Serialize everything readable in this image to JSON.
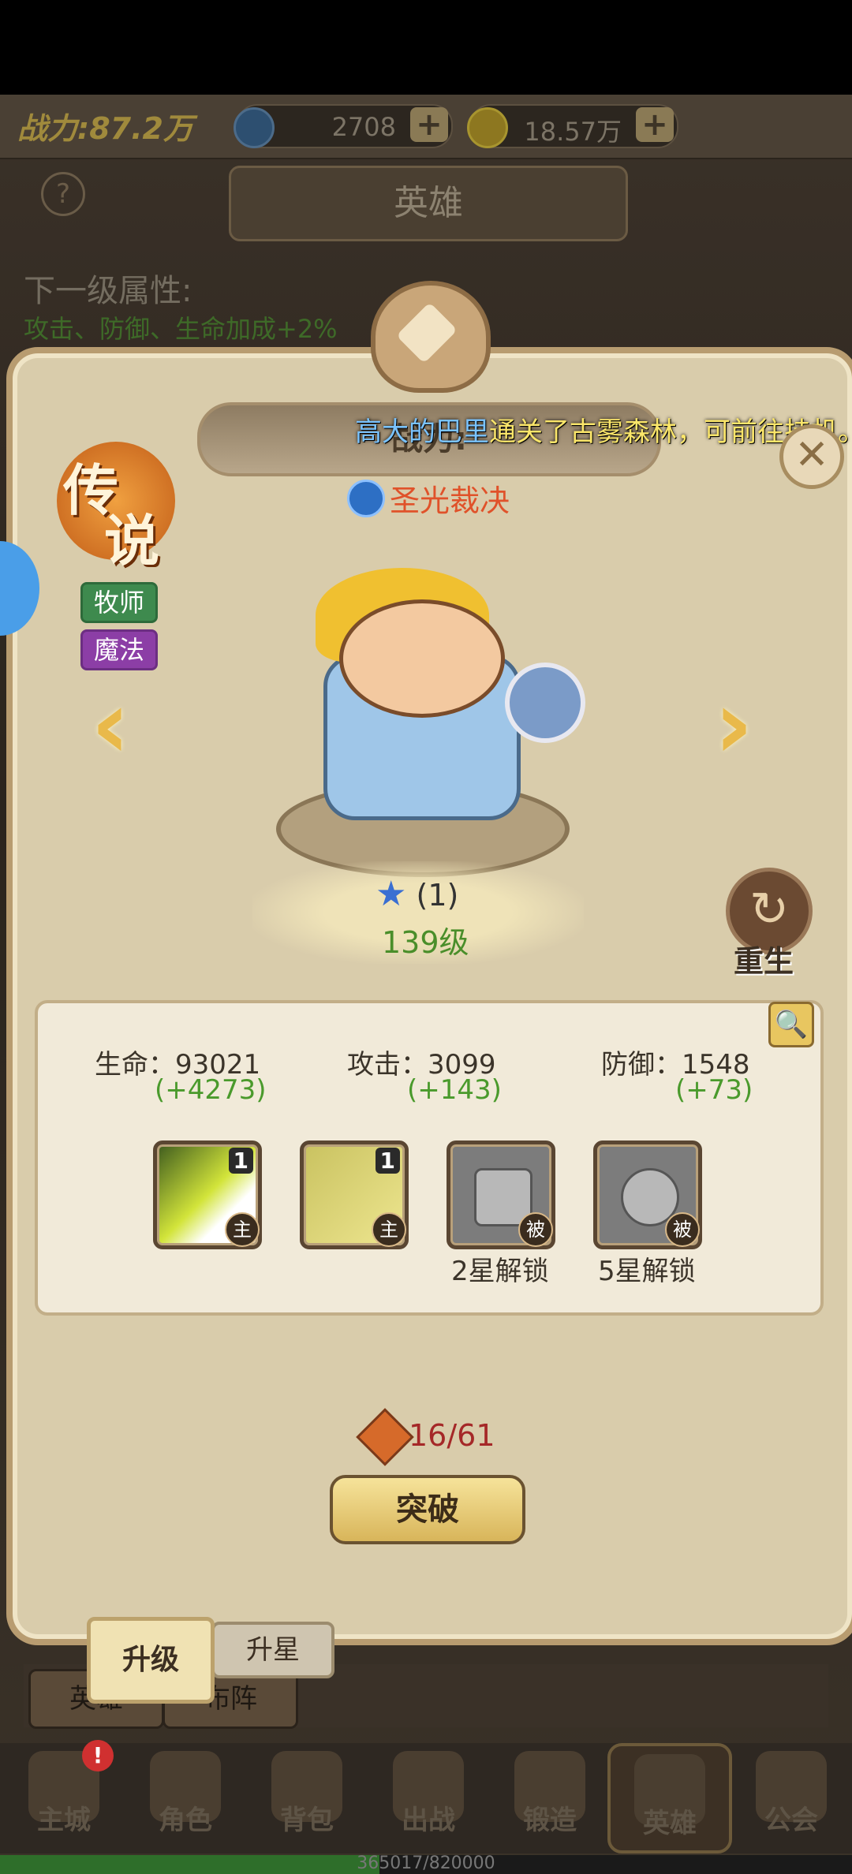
{
  "topbar": {
    "power": "战力:87.2万",
    "gems": "2708",
    "gold": "18.57万"
  },
  "page_title": "英雄",
  "help": "?",
  "next_level": {
    "title": "下一级属性:",
    "desc": "攻击、防御、生命加成+2%"
  },
  "marquee": {
    "prefix": "高大的巴里",
    "text": "通关了古雾森林，可前往挂机。"
  },
  "hero_power": "战力:",
  "close": "✕",
  "rarity": {
    "line1": "传",
    "line2": "说"
  },
  "tags": [
    "牧师",
    "魔法"
  ],
  "skill_name": "圣光裁决",
  "arrows": {
    "left": "‹",
    "right": "›"
  },
  "hero": {
    "stars": "(1)",
    "level": "139级"
  },
  "rebirth": {
    "label": "重生",
    "icon": "↻"
  },
  "stats": [
    {
      "label": "生命：93021",
      "bonus": "(+4273)"
    },
    {
      "label": "攻击：3099",
      "bonus": "(+143)"
    },
    {
      "label": "防御：1548",
      "bonus": "(+73)"
    }
  ],
  "skills": [
    {
      "count": "1",
      "mark": "主"
    },
    {
      "count": "1",
      "mark": "主"
    },
    {
      "mark": "被",
      "unlock": "2星解锁"
    },
    {
      "mark": "被",
      "unlock": "5星解锁"
    }
  ],
  "fragments": "16/61",
  "break_button": "突破",
  "tabs": {
    "upgrade": "升级",
    "star": "升星"
  },
  "subtabs": [
    "英雄",
    "布阵"
  ],
  "nav": [
    {
      "label": "主城",
      "icon": "castle-icon"
    },
    {
      "label": "角色",
      "icon": "crown-icon"
    },
    {
      "label": "背包",
      "icon": "bag-icon"
    },
    {
      "label": "出战",
      "icon": "swords-icon"
    },
    {
      "label": "锻造",
      "icon": "hammer-icon"
    },
    {
      "label": "英雄",
      "icon": "hero-icon"
    },
    {
      "label": "公会",
      "icon": "shield-icon"
    }
  ],
  "notification": "!",
  "xp": {
    "text": "365017/820000",
    "fraction": 0.445
  }
}
